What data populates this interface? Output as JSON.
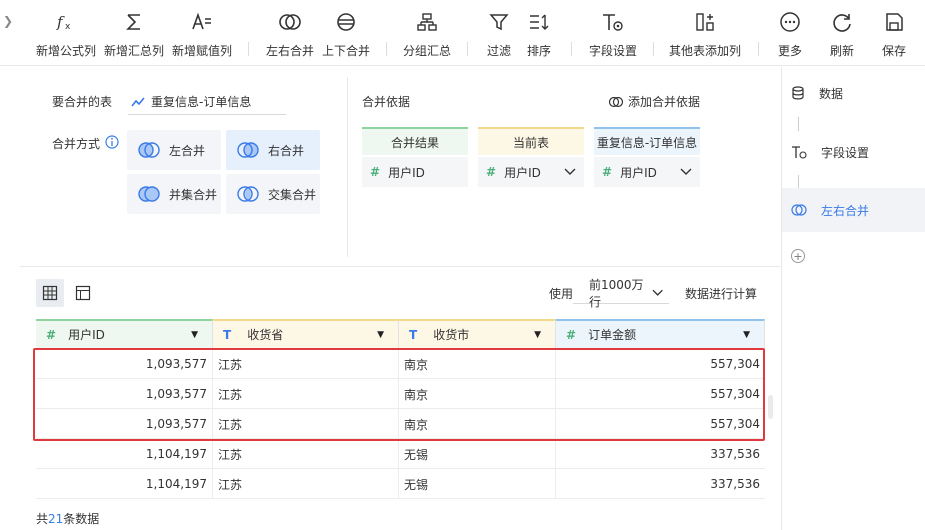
{
  "toolbar": {
    "items": [
      {
        "label": "新增公式列",
        "icon": "formula-icon"
      },
      {
        "label": "新增汇总列",
        "icon": "sum-icon"
      },
      {
        "label": "新增赋值列",
        "icon": "assign-icon"
      },
      {
        "label": "左右合并",
        "icon": "merge-lr-icon"
      },
      {
        "label": "上下合并",
        "icon": "merge-ud-icon"
      },
      {
        "label": "分组汇总",
        "icon": "group-icon"
      },
      {
        "label": "过滤",
        "icon": "filter-icon"
      },
      {
        "label": "排序",
        "icon": "sort-icon"
      },
      {
        "label": "字段设置",
        "icon": "field-settings-icon"
      },
      {
        "label": "其他表添加列",
        "icon": "add-column-icon"
      },
      {
        "label": "更多",
        "icon": "more-icon"
      },
      {
        "label": "刷新",
        "icon": "refresh-icon"
      },
      {
        "label": "保存",
        "icon": "save-icon"
      }
    ]
  },
  "config": {
    "source_label": "要合并的表",
    "source_table": "重复信息-订单信息",
    "mode_label": "合并方式",
    "modes": [
      "左合并",
      "右合并",
      "并集合并",
      "交集合并"
    ],
    "active_mode": "右合并",
    "basis_label": "合并依据",
    "add_basis": "添加合并依据",
    "columns": [
      {
        "header": "合并结果",
        "field": "用户ID",
        "color": "#8fd3a0"
      },
      {
        "header": "当前表",
        "field": "用户ID",
        "color": "#f5d98a"
      },
      {
        "header": "重复信息-订单信息",
        "field": "用户ID",
        "color": "#8fc3ee"
      }
    ]
  },
  "steps": {
    "items": [
      {
        "label": "数据",
        "icon": "database-icon"
      },
      {
        "label": "字段设置",
        "icon": "field-settings-icon"
      },
      {
        "label": "左右合并",
        "icon": "merge-lr-icon"
      }
    ],
    "active": "左右合并"
  },
  "table": {
    "use_label": "使用",
    "row_limit": "前1000万行",
    "calc_suffix": "数据进行计算",
    "headers": [
      {
        "label": "用户ID",
        "type": "#",
        "color": "#8fd3a0"
      },
      {
        "label": "收货省",
        "type": "T",
        "color": "#f5d98a"
      },
      {
        "label": "收货市",
        "type": "T",
        "color": "#f5d98a"
      },
      {
        "label": "订单金额",
        "type": "#",
        "color": "#8fc3ee"
      }
    ],
    "rows": [
      [
        "1,093,577",
        "江苏",
        "南京",
        "557,304"
      ],
      [
        "1,093,577",
        "江苏",
        "南京",
        "557,304"
      ],
      [
        "1,093,577",
        "江苏",
        "南京",
        "557,304"
      ],
      [
        "1,104,197",
        "江苏",
        "无锡",
        "337,536"
      ],
      [
        "1,104,197",
        "江苏",
        "无锡",
        "337,536"
      ]
    ],
    "footer_prefix": "共",
    "footer_count": "21",
    "footer_suffix": "条数据"
  }
}
